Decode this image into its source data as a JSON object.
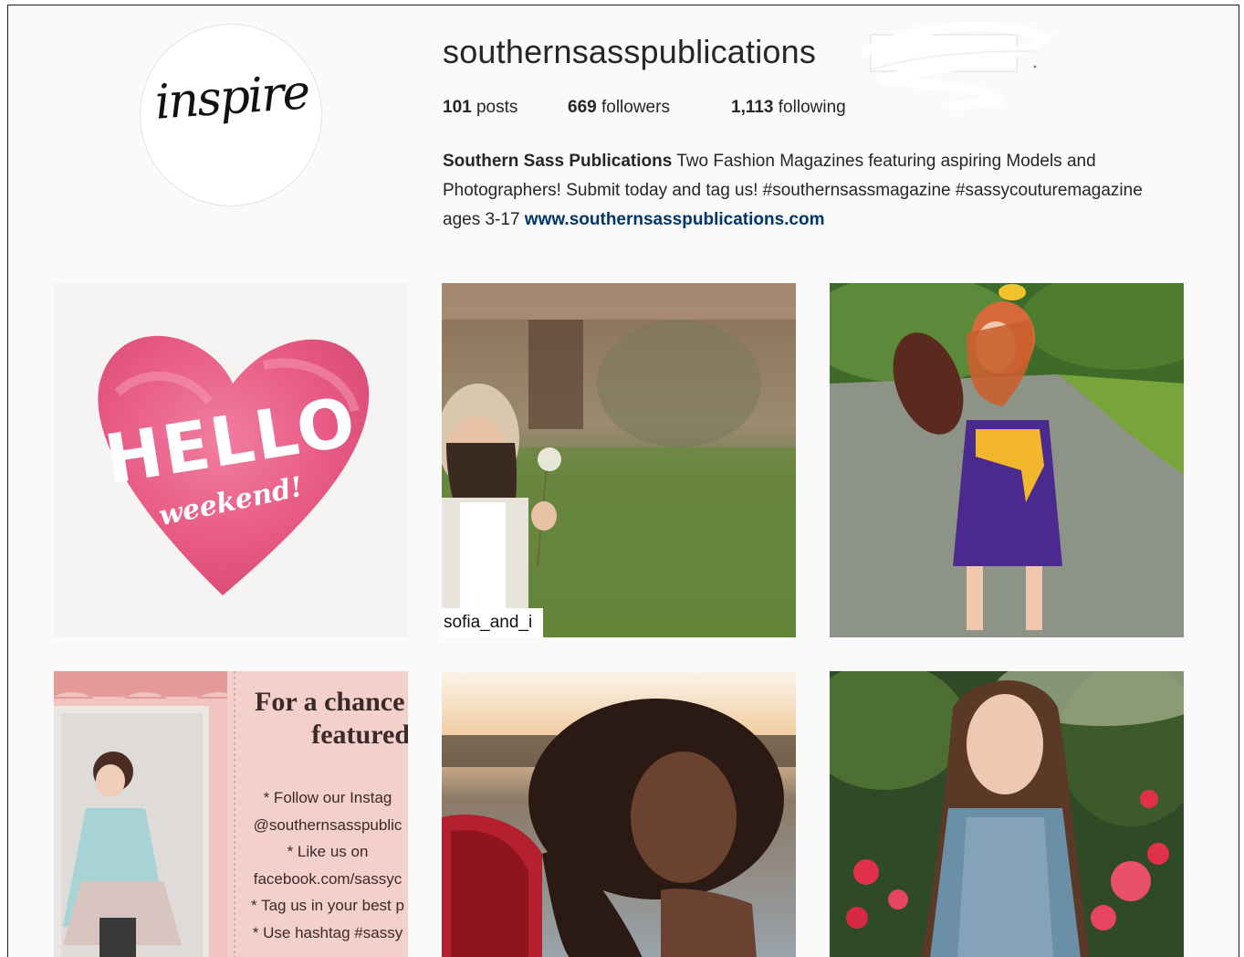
{
  "profile": {
    "avatar_text": "inspire",
    "username": "southernsasspublications",
    "stats": {
      "posts_count": "101",
      "posts_label": "posts",
      "followers_count": "669",
      "followers_label": "followers",
      "following_count": "1,113",
      "following_label": "following"
    },
    "bio": {
      "name": "Southern Sass Publications",
      "text": " Two Fashion Magazines featuring aspiring Models and Photographers! Submit today and tag us! #southernsassmagazine #sassycouturemagazine ages 3-17 ",
      "link": "www.southernsasspublications.com"
    }
  },
  "posts": [
    {
      "hello": "HELLO",
      "weekend": "weekend!"
    },
    {
      "tag": "sofia_and_i"
    },
    {},
    {
      "title_line1": "For a chance t",
      "title_line2": "featured:",
      "lines": [
        "* Follow our Instag",
        "@southernsasspublic",
        "* Like us on",
        "facebook.com/sassyc",
        "* Tag us in your best p",
        "* Use hashtag #sassy"
      ]
    },
    {},
    {}
  ],
  "colors": {
    "background": "#fafafa",
    "text": "#262626",
    "link": "#003569",
    "heart": "#e85b86"
  }
}
